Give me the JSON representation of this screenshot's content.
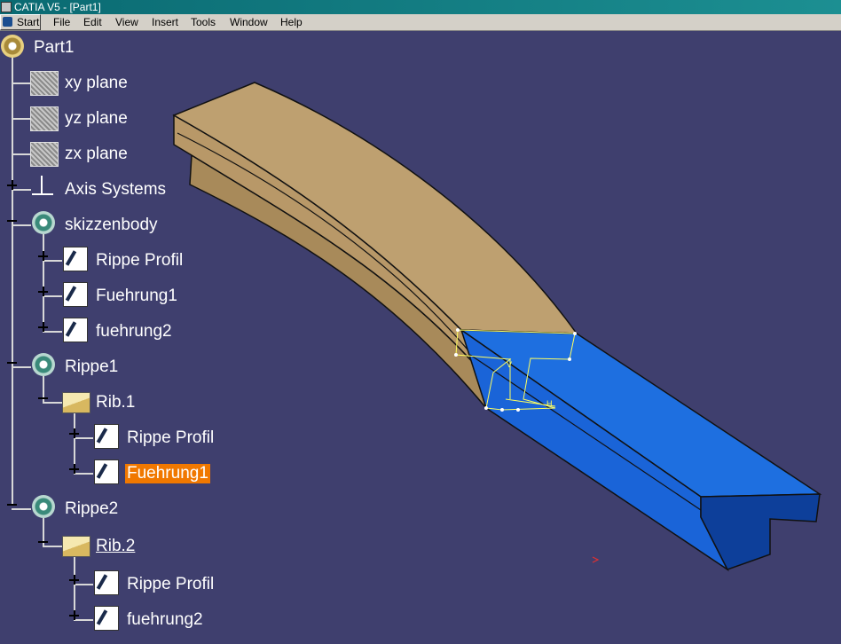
{
  "window": {
    "title": "CATIA V5 - [Part1]"
  },
  "menu": {
    "items": [
      "Start",
      "File",
      "Edit",
      "View",
      "Insert",
      "Tools",
      "Window",
      "Help"
    ]
  },
  "tree": {
    "root": "Part1",
    "items": [
      {
        "label": "xy plane",
        "icon": "plane-icon"
      },
      {
        "label": "yz plane",
        "icon": "plane-icon"
      },
      {
        "label": "zx plane",
        "icon": "plane-icon"
      },
      {
        "label": "Axis Systems",
        "icon": "axis-system-icon"
      },
      {
        "label": "skizzenbody",
        "icon": "body-icon"
      },
      {
        "label": "Rippe Profil",
        "icon": "sketch-icon"
      },
      {
        "label": "Fuehrung1",
        "icon": "sketch-icon"
      },
      {
        "label": "fuehrung2",
        "icon": "sketch-icon"
      },
      {
        "label": "Rippe1",
        "icon": "body-icon"
      },
      {
        "label": "Rib.1",
        "icon": "rib-icon"
      },
      {
        "label": "Rippe Profil",
        "icon": "sketch-icon"
      },
      {
        "label": "Fuehrung1",
        "icon": "sketch-icon",
        "selected": true
      },
      {
        "label": "Rippe2",
        "icon": "body-icon"
      },
      {
        "label": "Rib.2",
        "icon": "rib-icon"
      },
      {
        "label": "Rippe Profil",
        "icon": "sketch-icon"
      },
      {
        "label": "fuehrung2",
        "icon": "sketch-icon"
      }
    ]
  },
  "colors": {
    "background": "#3f3f6e",
    "rib_tan": "#b89868",
    "rib_blue": "#1a64d8",
    "selection": "#f07800"
  }
}
